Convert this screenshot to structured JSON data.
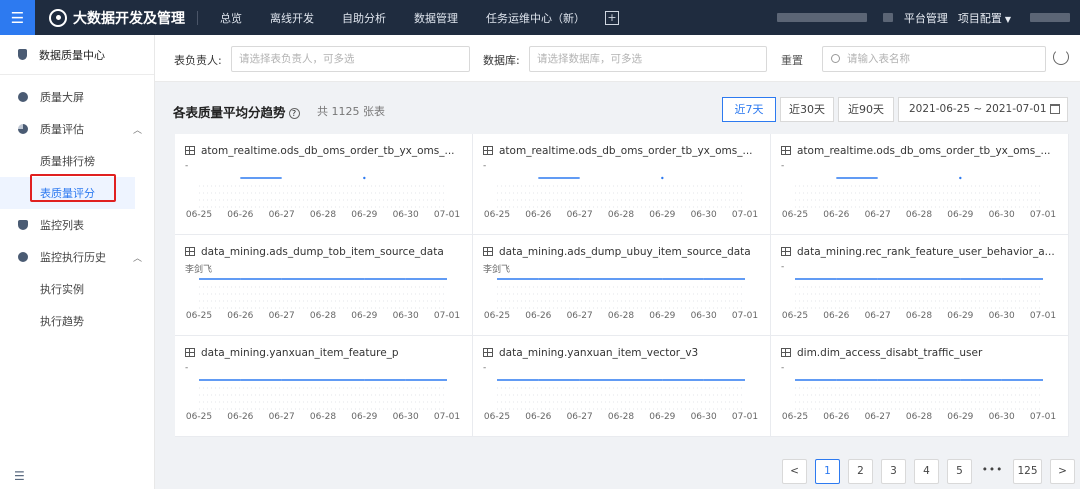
{
  "topbar": {
    "app_name": "大数据开发及管理",
    "nav": [
      "总览",
      "离线开发",
      "自助分析",
      "数据管理",
      "任务运维中心（新）"
    ],
    "platform_mgmt": "平台管理",
    "project_config": "项目配置"
  },
  "sidebar": {
    "header": "数据质量中心",
    "items": [
      {
        "label": "质量大屏"
      },
      {
        "label": "质量评估"
      },
      {
        "label": "质量排行榜"
      },
      {
        "label": "表质量评分"
      },
      {
        "label": "监控列表"
      },
      {
        "label": "监控执行历史"
      },
      {
        "label": "执行实例"
      },
      {
        "label": "执行趋势"
      }
    ]
  },
  "filters": {
    "owner_label": "表负责人:",
    "owner_placeholder": "请选择表负责人，可多选",
    "db_label": "数据库:",
    "db_placeholder": "请选择数据库，可多选",
    "reset": "重置",
    "search_placeholder": "请输入表名称"
  },
  "section": {
    "title": "各表质量平均分趋势",
    "count": "共 1125 张表",
    "ranges": [
      "近7天",
      "近30天",
      "近90天"
    ],
    "date_range": "2021-06-25 ~ 2021-07-01"
  },
  "cards": [
    {
      "title": "atom_realtime.ods_db_oms_order_tb_yx_oms_...",
      "owner": "-"
    },
    {
      "title": "atom_realtime.ods_db_oms_order_tb_yx_oms_...",
      "owner": "-"
    },
    {
      "title": "atom_realtime.ods_db_oms_order_tb_yx_oms_...",
      "owner": "-"
    },
    {
      "title": "data_mining.ads_dump_tob_item_source_data",
      "owner": "李剑飞"
    },
    {
      "title": "data_mining.ads_dump_ubuy_item_source_data",
      "owner": "李剑飞"
    },
    {
      "title": "data_mining.rec_rank_feature_user_behavior_a...",
      "owner": "-"
    },
    {
      "title": "data_mining.yanxuan_item_feature_p",
      "owner": "-"
    },
    {
      "title": "data_mining.yanxuan_item_vector_v3",
      "owner": "-"
    },
    {
      "title": "dim.dim_access_disabt_traffic_user",
      "owner": "-"
    }
  ],
  "chart_data": {
    "type": "line",
    "x": [
      "06-25",
      "06-26",
      "06-27",
      "06-28",
      "06-29",
      "06-30",
      "07-01"
    ],
    "accent_color": "#2d7af0",
    "cards_series": [
      [
        null,
        1,
        1,
        null,
        1,
        null,
        null
      ],
      [
        null,
        1,
        1,
        null,
        1,
        null,
        null
      ],
      [
        null,
        1,
        1,
        null,
        1,
        null,
        null
      ],
      [
        1,
        1,
        1,
        1,
        1,
        1,
        1
      ],
      [
        1,
        1,
        1,
        1,
        1,
        1,
        1
      ],
      [
        1,
        1,
        1,
        1,
        1,
        1,
        1
      ],
      [
        1,
        1,
        1,
        1,
        1,
        1,
        1
      ],
      [
        1,
        1,
        1,
        1,
        1,
        1,
        1
      ],
      [
        1,
        1,
        1,
        1,
        1,
        1,
        1
      ]
    ]
  },
  "pagination": {
    "pages": [
      "1",
      "2",
      "3",
      "4",
      "5"
    ],
    "dots": "•••",
    "last": "125",
    "prev": "<",
    "next": ">"
  }
}
